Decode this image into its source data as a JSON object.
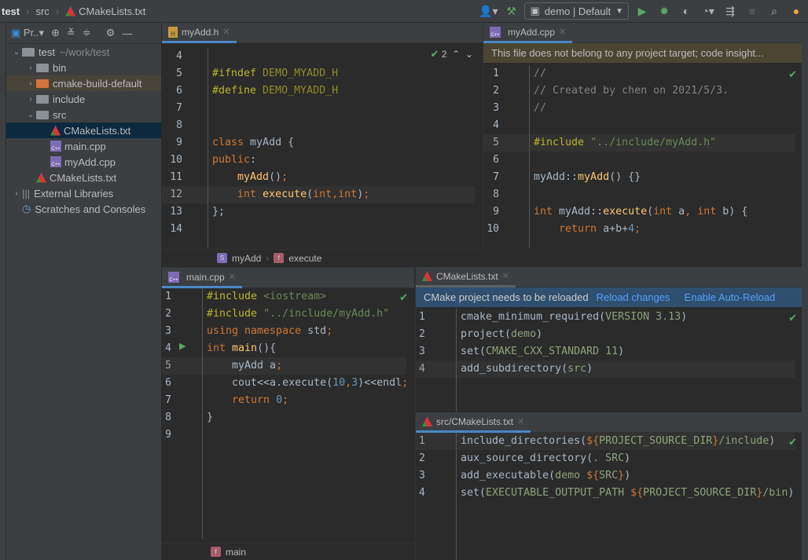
{
  "navbar": {
    "crumbs": [
      "test",
      "src",
      "CMakeLists.txt"
    ],
    "run_config": "demo | Default",
    "icons": [
      "user-icon",
      "build-hammer-icon",
      "run-icon",
      "debug-icon",
      "coverage-icon",
      "profile-icon",
      "attach-icon",
      "stop-icon",
      "search-icon"
    ]
  },
  "project": {
    "toolbar_label": "Pr..",
    "tree": [
      {
        "label": "test",
        "hint": "~/work/test",
        "level": 0,
        "kind": "folder",
        "open": true
      },
      {
        "label": "bin",
        "level": 1,
        "kind": "folder",
        "open": false
      },
      {
        "label": "cmake-build-default",
        "level": 1,
        "kind": "folder-excluded",
        "open": false
      },
      {
        "label": "include",
        "level": 1,
        "kind": "folder",
        "open": false
      },
      {
        "label": "src",
        "level": 1,
        "kind": "folder",
        "open": true
      },
      {
        "label": "CMakeLists.txt",
        "level": 2,
        "kind": "cmake",
        "selected": true
      },
      {
        "label": "main.cpp",
        "level": 2,
        "kind": "cpp"
      },
      {
        "label": "myAdd.cpp",
        "level": 2,
        "kind": "cpp"
      },
      {
        "label": "CMakeLists.txt",
        "level": 1,
        "kind": "cmake"
      },
      {
        "label": "External Libraries",
        "level": 0,
        "kind": "libs",
        "open": false
      },
      {
        "label": "Scratches and Consoles",
        "level": 0,
        "kind": "scratch"
      }
    ]
  },
  "editors": {
    "myadd_h": {
      "tab": "myAdd.h",
      "inspection_count": "2",
      "breadcrumb": [
        "myAdd",
        "execute"
      ],
      "first_line": 4,
      "current_line": 12,
      "lines": [
        [],
        [
          [
            "#ifndef ",
            "pp"
          ],
          [
            "DEMO_MYADD_H",
            "m"
          ]
        ],
        [
          [
            "#define ",
            "pp"
          ],
          [
            "DEMO_MYADD_H",
            "m"
          ]
        ],
        [],
        [],
        [
          [
            "class ",
            "k"
          ],
          [
            "myAdd ",
            "c"
          ],
          [
            "{",
            "c"
          ]
        ],
        [
          [
            "public",
            ""
          ],
          [
            ":",
            "c"
          ]
        ],
        [
          [
            "    "
          ],
          [
            "myAdd",
            "f"
          ],
          [
            "()",
            "c"
          ],
          [
            ";",
            "k"
          ]
        ],
        [
          [
            "    "
          ],
          [
            "int ",
            "k"
          ],
          [
            "execute",
            "f"
          ],
          [
            "(",
            "c"
          ],
          [
            "int",
            "k"
          ],
          [
            ",",
            "k"
          ],
          [
            "int",
            "k"
          ],
          [
            ")",
            "c"
          ],
          [
            ";",
            "k"
          ]
        ],
        [
          [
            "};",
            "c"
          ]
        ],
        []
      ]
    },
    "myadd_cpp": {
      "tab": "myAdd.cpp",
      "banner": "This file does not belong to any project target; code insight...",
      "first_line": 1,
      "current_line": 5,
      "lines": [
        [
          [
            "//",
            "cm"
          ]
        ],
        [
          [
            "// Created by chen on 2021/5/3.",
            "cm"
          ]
        ],
        [
          [
            "//",
            "cm"
          ]
        ],
        [],
        [
          [
            "#include ",
            "pp"
          ],
          [
            "\"../include/myAdd.h\"",
            "s"
          ]
        ],
        [],
        [
          [
            "myAdd::",
            "c"
          ],
          [
            "myAdd",
            "f"
          ],
          [
            "() {}",
            "c"
          ]
        ],
        [],
        [
          [
            "int ",
            "k"
          ],
          [
            "myAdd::",
            "c"
          ],
          [
            "execute",
            "f"
          ],
          [
            "(",
            "c"
          ],
          [
            "int ",
            "k"
          ],
          [
            "a",
            "c"
          ],
          [
            ", ",
            "k"
          ],
          [
            "int ",
            "k"
          ],
          [
            "b",
            "c"
          ],
          [
            ") {",
            "c"
          ]
        ],
        [
          [
            "    "
          ],
          [
            "return ",
            "k"
          ],
          [
            "a+b+",
            "c"
          ],
          [
            "4",
            "n"
          ],
          [
            ";",
            "k"
          ]
        ]
      ]
    },
    "main_cpp": {
      "tab": "main.cpp",
      "breadcrumb": [
        "main"
      ],
      "first_line": 1,
      "current_line": 5,
      "lines": [
        [
          [
            "#include ",
            "pp"
          ],
          [
            "<iostream>",
            "s"
          ]
        ],
        [
          [
            "#include ",
            "pp"
          ],
          [
            "\"../include/myAdd.h\"",
            "s"
          ]
        ],
        [
          [
            "using namespace ",
            "k"
          ],
          [
            "std",
            "c"
          ],
          [
            ";",
            "k"
          ]
        ],
        [
          [
            "int ",
            "k"
          ],
          [
            "main",
            "f"
          ],
          [
            "(){",
            "c"
          ]
        ],
        [
          [
            "    myAdd a",
            "c"
          ],
          [
            ";",
            "k"
          ]
        ],
        [
          [
            "    cout<<a.execute(",
            "c"
          ],
          [
            "10",
            "n"
          ],
          [
            ",",
            "k"
          ],
          [
            "3",
            "n"
          ],
          [
            ")<<endl",
            "c"
          ],
          [
            ";",
            "k"
          ]
        ],
        [
          [
            "    "
          ],
          [
            "return ",
            "k"
          ],
          [
            "0",
            "n"
          ],
          [
            ";",
            "k"
          ]
        ],
        [
          [
            "}",
            "c"
          ]
        ],
        []
      ]
    },
    "cmakelists": {
      "tab": "CMakeLists.txt",
      "banner": "CMake project needs to be reloaded",
      "reload": "Reload changes",
      "auto_reload": "Enable Auto-Reload",
      "first_line": 1,
      "current_line": 4,
      "lines": [
        [
          [
            "cmake_minimum_required(",
            "c"
          ],
          [
            "VERSION 3.13",
            "a"
          ],
          [
            ")",
            "c"
          ]
        ],
        [
          [
            "project(",
            "c"
          ],
          [
            "demo",
            "a"
          ],
          [
            ")",
            "c"
          ]
        ],
        [
          [
            "set(",
            "c"
          ],
          [
            "CMAKE_CXX_STANDARD 11",
            "a"
          ],
          [
            ")",
            "c"
          ]
        ],
        [
          [
            "add_subdirectory(",
            "c"
          ],
          [
            "src",
            "a"
          ],
          [
            ")",
            "c"
          ]
        ]
      ]
    },
    "src_cmakelists": {
      "tab": "src/CMakeLists.txt",
      "first_line": 1,
      "current_line": 1,
      "lines": [
        [
          [
            "include_directories(",
            "c"
          ],
          [
            "${",
            "v"
          ],
          [
            "PROJECT_SOURCE_DIR",
            "a"
          ],
          [
            "}",
            "v"
          ],
          [
            "/include",
            "a"
          ],
          [
            ")",
            "c"
          ]
        ],
        [
          [
            "aux_source_directory(",
            "c"
          ],
          [
            ". SRC",
            "a"
          ],
          [
            ")",
            "c"
          ]
        ],
        [
          [
            "add_executable(",
            "c"
          ],
          [
            "demo ",
            "a"
          ],
          [
            "${",
            "v"
          ],
          [
            "SRC",
            "a"
          ],
          [
            "}",
            "v"
          ],
          [
            ")",
            "c"
          ]
        ],
        [
          [
            "set(",
            "c"
          ],
          [
            "EXECUTABLE_OUTPUT_PATH ",
            "a"
          ],
          [
            "${",
            "v"
          ],
          [
            "PROJECT_SOURCE_DIR",
            "a"
          ],
          [
            "}",
            "v"
          ],
          [
            "/bin",
            "a"
          ],
          [
            ")",
            "c"
          ]
        ]
      ]
    }
  },
  "colors": {
    "keyword": "#cc7832",
    "function": "#ffc66d",
    "string": "#6a8759",
    "number": "#6897bb",
    "preprocessor": "#bbb529",
    "selection": "#0d293e",
    "link": "#589df6",
    "banner_blue": "#2f4f6f",
    "banner_yellow": "#4a4632"
  }
}
